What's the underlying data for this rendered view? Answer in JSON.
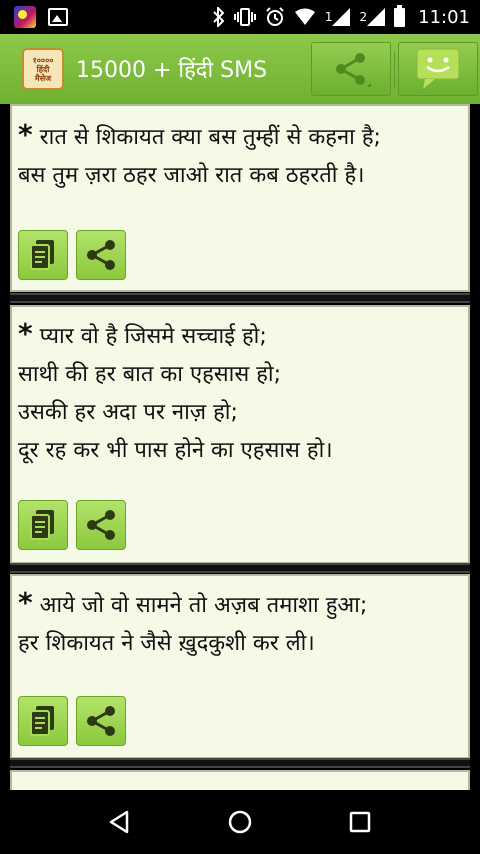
{
  "status_bar": {
    "time": "11:01",
    "sim1_label": "1",
    "sim2_label": "2",
    "icons": [
      "app-notification-icon",
      "image-notification-icon",
      "bluetooth-icon",
      "vibrate-icon",
      "alarm-icon",
      "wifi-icon",
      "signal-icon",
      "battery-icon"
    ]
  },
  "app_bar": {
    "logo_line1": "१००००",
    "logo_line2": "हिंदी",
    "logo_line3": "मैसेज",
    "title": "15000 + हिंदी SMS",
    "share_icon": "share-icon",
    "sms_icon": "smiley-chat-icon"
  },
  "colors": {
    "app_bar": "#7dbe3e",
    "card_bg": "#f5fae6",
    "button": "#9fd653"
  },
  "messages": [
    {
      "star": "*",
      "text": " रात से शिकायत क्या बस तुम्हीं से कहना है;\nबस तुम ज़रा ठहर जाओ रात कब ठहरती है।"
    },
    {
      "star": "*",
      "text": " प्यार वो है जिसमे सच्चाई हो;\nसाथी की हर बात का एहसास हो;\nउसकी हर अदा पर नाज़ हो;\nदूर रह कर भी पास होने का एहसास हो।"
    },
    {
      "star": "*",
      "text": " आये जो वो सामने तो अज़ब तमाशा हुआ;\nहर शिकायत ने जैसे ख़ुदकुशी कर ली।"
    }
  ],
  "nav_bar": {
    "icons": [
      "back-icon",
      "home-icon",
      "recents-icon"
    ]
  }
}
